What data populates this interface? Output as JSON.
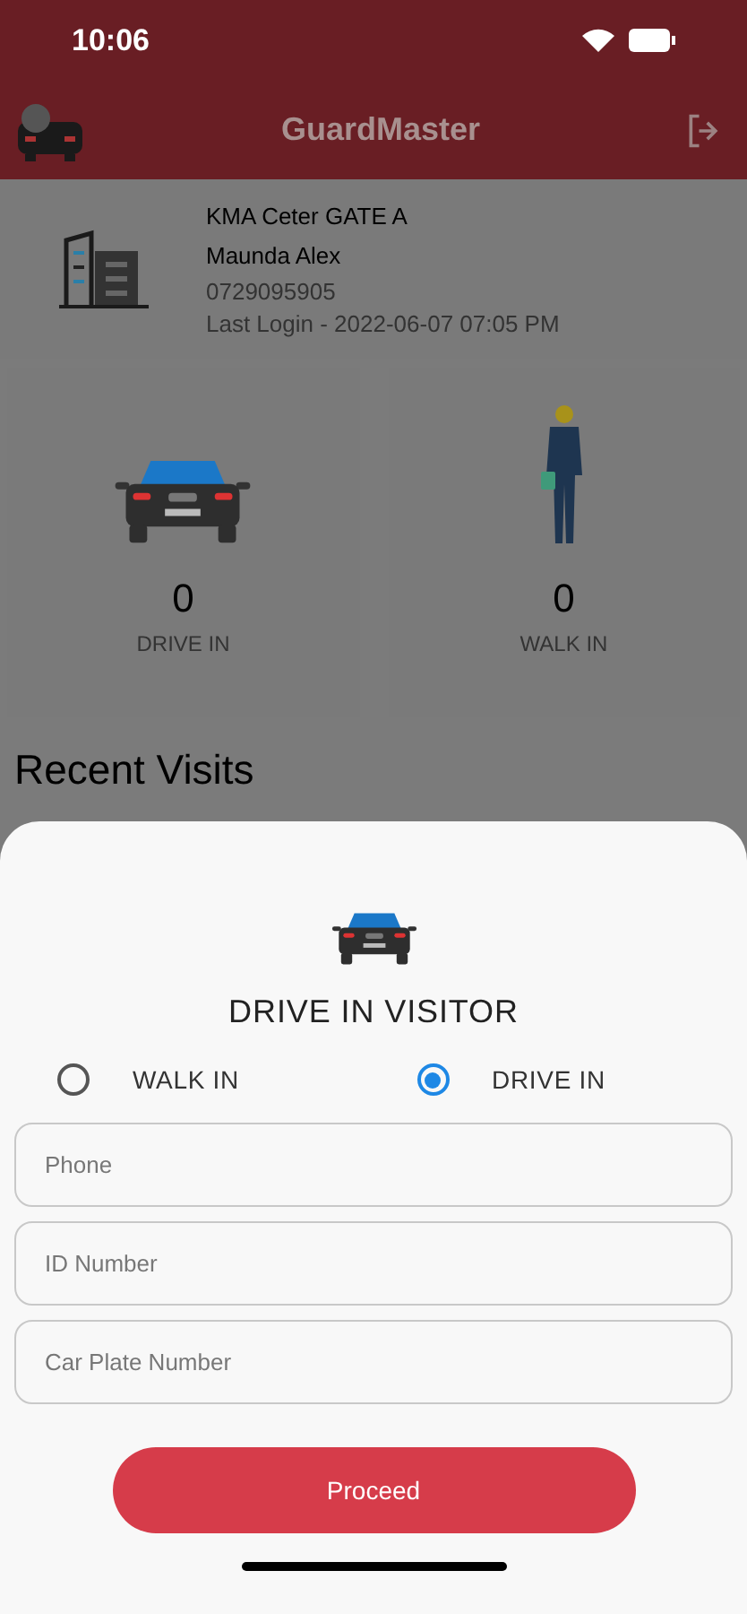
{
  "status_bar": {
    "time": "10:06"
  },
  "app_bar": {
    "title": "GuardMaster"
  },
  "gate": {
    "name": "KMA Ceter GATE A",
    "guard": "Maunda Alex",
    "phone": "0729095905",
    "last_login": "Last Login - 2022-06-07 07:05 PM"
  },
  "stats": [
    {
      "kind": "car",
      "count": "0",
      "label": "DRIVE IN"
    },
    {
      "kind": "person",
      "count": "0",
      "label": "WALK IN"
    }
  ],
  "recent_visits": {
    "title": "Recent Visits"
  },
  "sheet": {
    "title": "DRIVE IN VISITOR",
    "options": [
      {
        "label": "WALK IN",
        "selected": false
      },
      {
        "label": "DRIVE IN",
        "selected": true
      }
    ],
    "fields": [
      {
        "placeholder": "Phone"
      },
      {
        "placeholder": "ID Number"
      },
      {
        "placeholder": "Car Plate Number"
      }
    ],
    "button": "Proceed"
  }
}
